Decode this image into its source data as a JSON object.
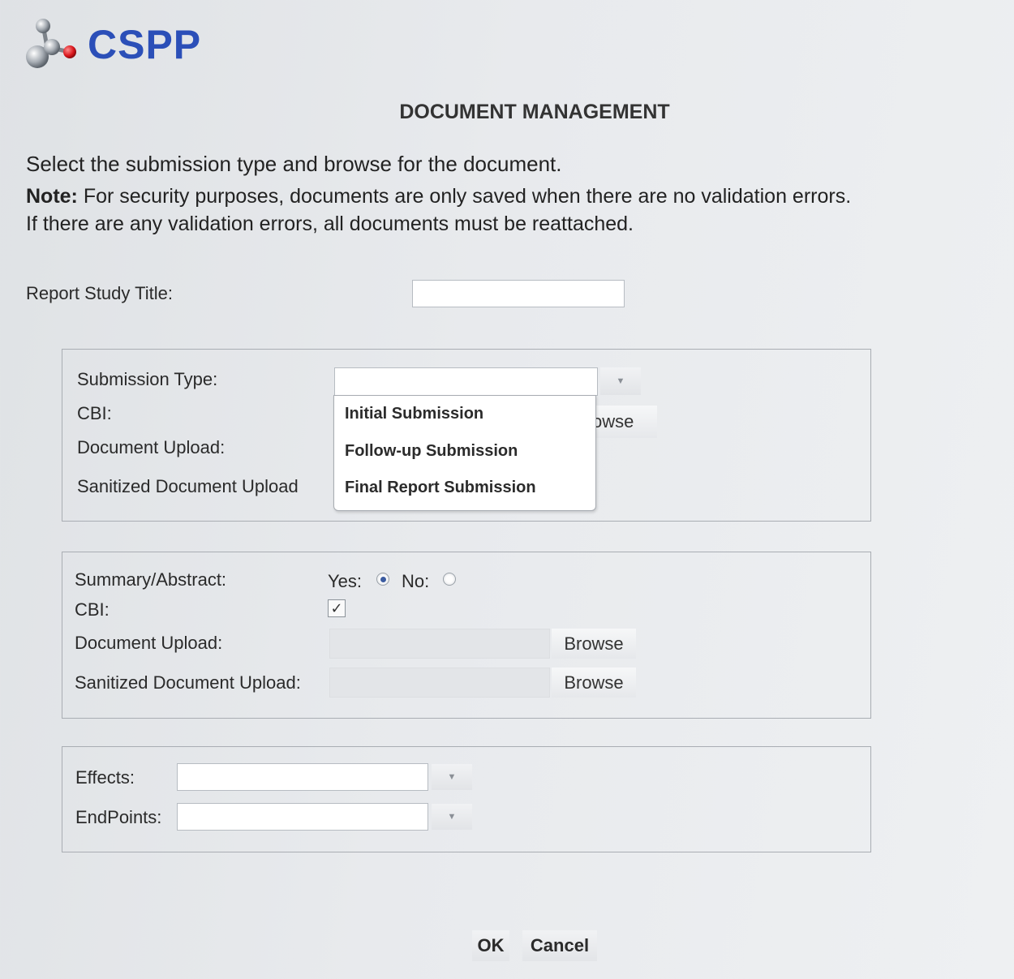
{
  "header": {
    "logo_text": "CSPP",
    "page_title": "DOCUMENT MANAGEMENT"
  },
  "instructions": {
    "intro": "Select the submission type and browse for the document.",
    "note_label": "Note:",
    "note_text": " For security purposes, documents are only saved when there are no validation errors.",
    "note_line2": "If there are any validation errors, all documents must be reattached."
  },
  "report": {
    "title_label": "Report Study Title:",
    "title_value": ""
  },
  "submission_panel": {
    "type_label": "Submission Type:",
    "type_value": "",
    "cbi_label": "CBI:",
    "doc_upload_label": "Document Upload:",
    "sanitized_label": "Sanitized Document Upload",
    "browse_partial": "owse",
    "dropdown_options": [
      "Initial Submission",
      "Follow-up Submission",
      "Final Report Submission"
    ]
  },
  "summary_panel": {
    "summary_label": "Summary/Abstract:",
    "yes_label": "Yes:",
    "no_label": "No:",
    "selected": "Yes",
    "cbi_label": "CBI:",
    "cbi_checked": true,
    "checkmark": "✓",
    "doc_upload_label": "Document Upload:",
    "sanitized_label": "Sanitized Document Upload:",
    "browse_label": "Browse"
  },
  "effects_panel": {
    "effects_label": "Effects:",
    "effects_value": "",
    "endpoints_label": "EndPoints:",
    "endpoints_value": ""
  },
  "actions": {
    "ok_label": "OK",
    "cancel_label": "Cancel"
  },
  "icons": {
    "logo": "molecule-logo-icon",
    "dropdown_arrow": "chevron-down-icon"
  },
  "colors": {
    "brand": "#2b4fb8",
    "logo_red": "#d8151b"
  }
}
